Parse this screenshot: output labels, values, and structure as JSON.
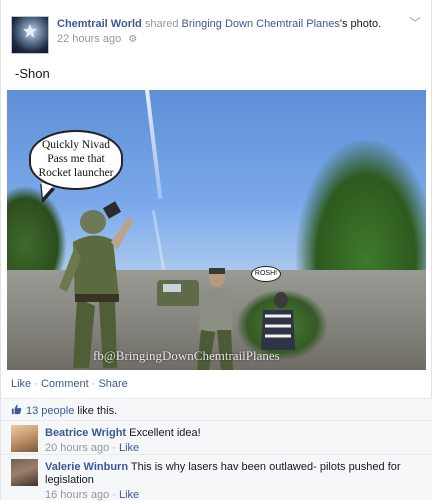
{
  "post": {
    "author": "Chemtrail World",
    "shared_text": "shared",
    "shared_page": "Bringing Down Chemtrail Planes",
    "possessive": "'s photo.",
    "time": "22 hours ago",
    "caption": "-Shon"
  },
  "photo": {
    "bubble_line1": "Quickly Nivad",
    "bubble_line2": "Pass me that",
    "bubble_line3": "Rocket launcher",
    "small_bubble": "ROSH!",
    "watermark": "fb@BringingDownChemtrailPlanes"
  },
  "actions": {
    "like": "Like",
    "comment": "Comment",
    "share": "Share",
    "sep": " · "
  },
  "likes": {
    "count_text": "13 people",
    "suffix": " like this."
  },
  "comments": [
    {
      "name": "Beatrice Wright",
      "text": "Excellent idea!",
      "time": "20 hours ago",
      "like": "Like"
    },
    {
      "name": "Valerie Winburn",
      "text": "This is why lasers hav been outlawed- pilots pushed for legislation",
      "time": "16 hours ago",
      "like": "Like"
    }
  ],
  "colors": {
    "link": "#3b5998",
    "meta": "#9197a3",
    "sky": "#7aa8ea"
  }
}
